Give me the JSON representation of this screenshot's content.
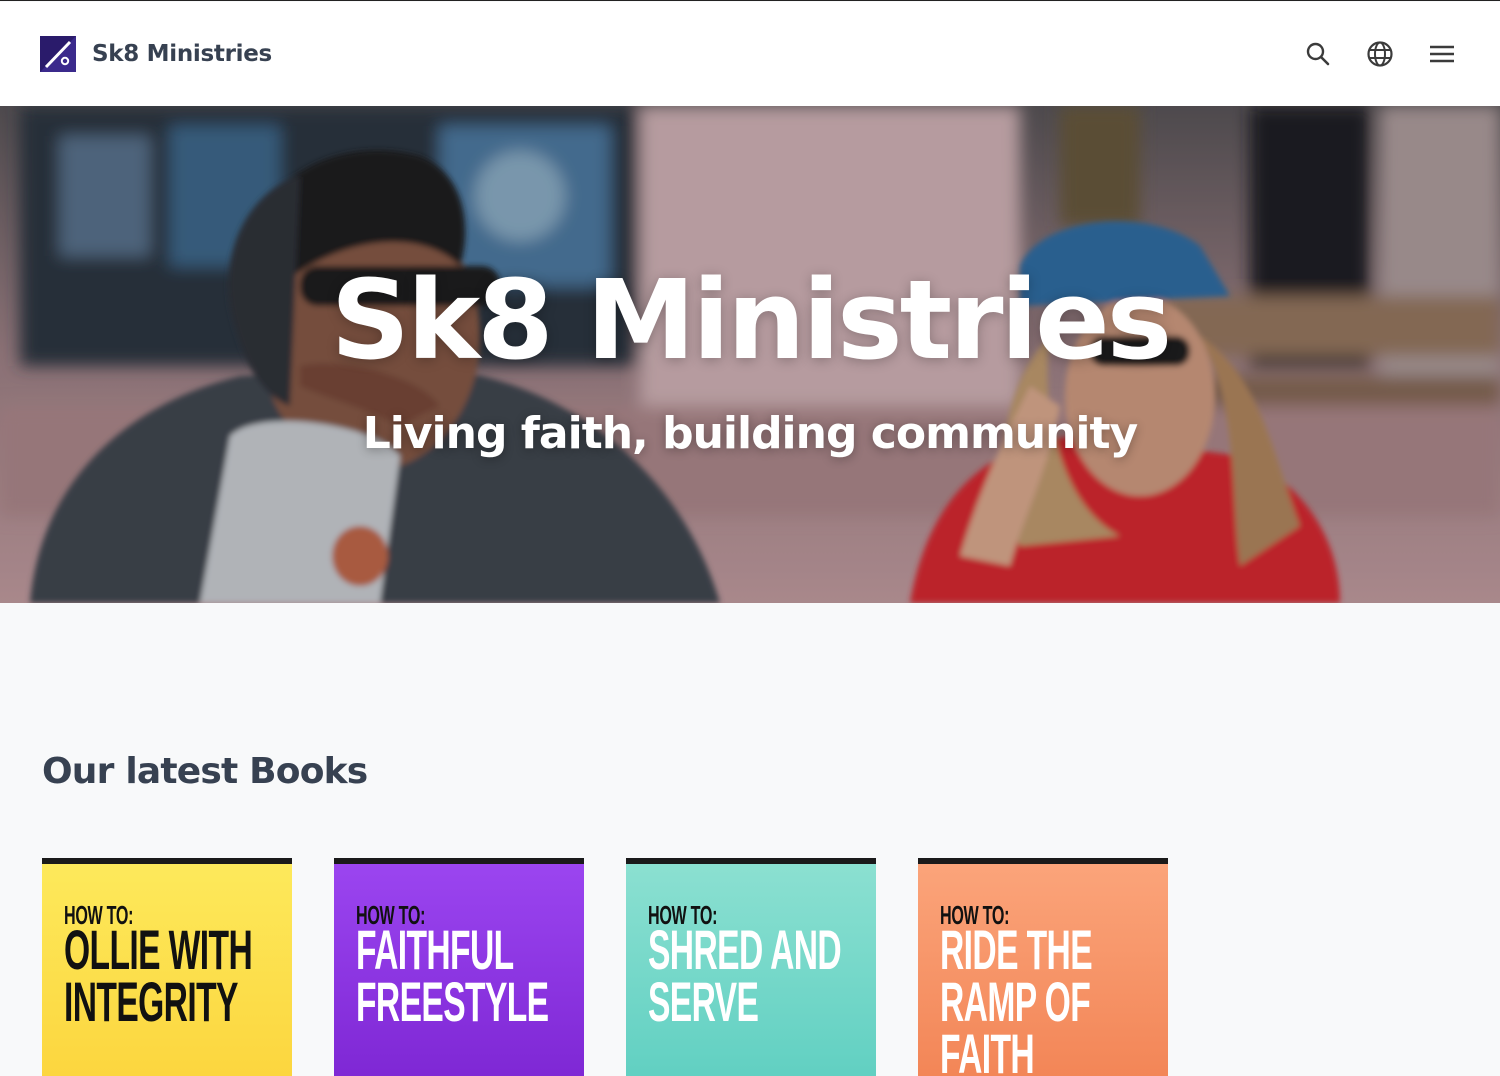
{
  "header": {
    "brand": "Sk8 Ministries",
    "logo_icon": "skateboard-logo-icon",
    "actions": [
      {
        "icon": "search-icon"
      },
      {
        "icon": "globe-icon"
      },
      {
        "icon": "hamburger-menu-icon"
      }
    ]
  },
  "hero": {
    "title": "Sk8 Ministries",
    "subtitle": "Living faith, building community"
  },
  "books_section": {
    "title": "Our latest Books",
    "books": [
      {
        "kicker": "HOW TO:",
        "title": "OLLIE WITH INTEGRITY",
        "color": "#fde047"
      },
      {
        "kicker": "HOW TO:",
        "title": "FAITHFUL FREESTYLE",
        "color": "#9333ea"
      },
      {
        "kicker": "HOW TO:",
        "title": "SHRED AND SERVE",
        "color": "#5eead4"
      },
      {
        "kicker": "HOW TO:",
        "title": "RIDE THE RAMP OF FAITH",
        "color": "#fb923c"
      }
    ]
  },
  "colors": {
    "brand_logo": "#2e1a6e",
    "text_dark": "#374151",
    "page_bg": "#f8f9fa"
  }
}
